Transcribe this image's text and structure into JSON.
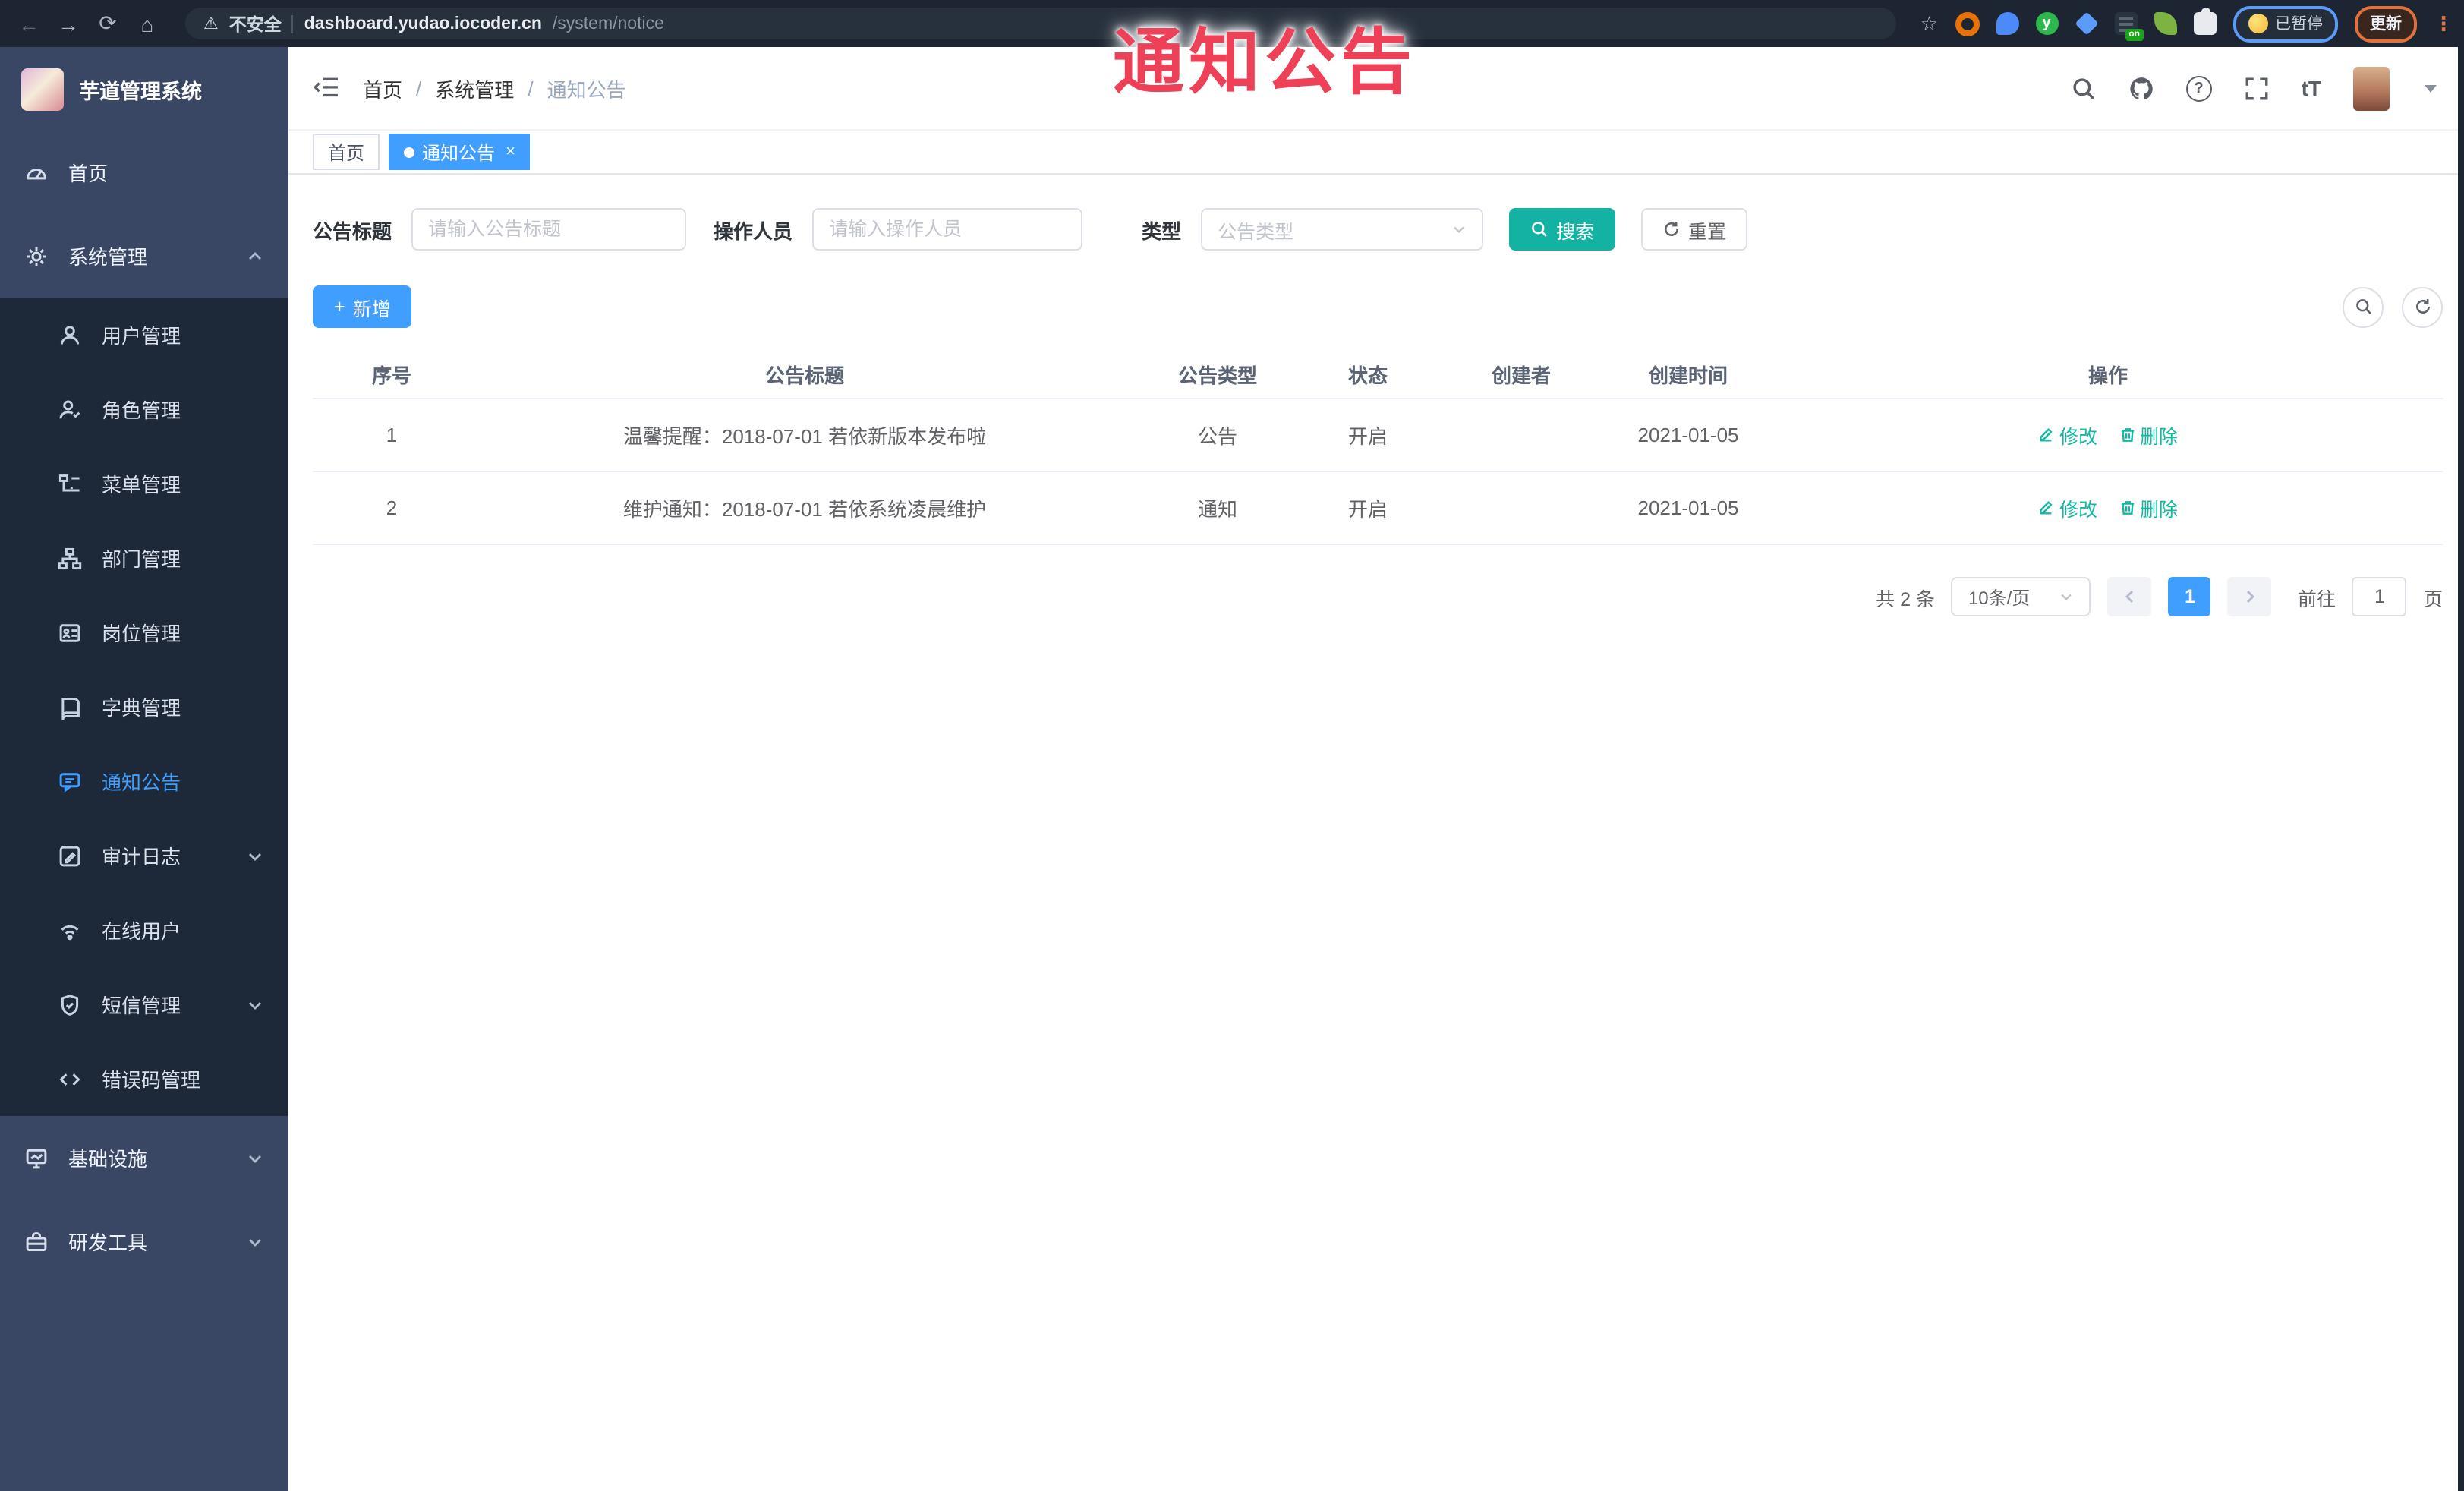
{
  "colors": {
    "accent": "#409eff",
    "teal": "#14b2a2",
    "overlay_red": "#ee4158",
    "sidebar_bg": "#3a4764",
    "submenu_bg": "#1d2838",
    "chrome_bg": "#1c2531"
  },
  "overlay": {
    "label": "通知公告"
  },
  "browser": {
    "insecure_label": "不安全",
    "url_domain": "dashboard.yudao.iocoder.cn",
    "url_path": "/system/notice",
    "ext_on_badge": "on",
    "ext_y_glyph": "y",
    "paused_label": "已暂停",
    "update_label": "更新",
    "kebab_glyph": "⋮",
    "back_glyph": "←",
    "forward_glyph": "→",
    "reload_glyph": "⟳",
    "home_glyph": "⌂",
    "star_glyph": "☆",
    "warn_glyph": "⚠"
  },
  "sidebar": {
    "app_title": "芋道管理系统",
    "items": [
      {
        "label": "首页"
      },
      {
        "label": "系统管理"
      },
      {
        "label": "用户管理"
      },
      {
        "label": "角色管理"
      },
      {
        "label": "菜单管理"
      },
      {
        "label": "部门管理"
      },
      {
        "label": "岗位管理"
      },
      {
        "label": "字典管理"
      },
      {
        "label": "通知公告"
      },
      {
        "label": "审计日志"
      },
      {
        "label": "在线用户"
      },
      {
        "label": "短信管理"
      },
      {
        "label": "错误码管理"
      },
      {
        "label": "基础设施"
      },
      {
        "label": "研发工具"
      }
    ]
  },
  "header": {
    "breadcrumb": [
      "首页",
      "系统管理",
      "通知公告"
    ],
    "breadcrumb_separator": "/",
    "help_glyph": "?",
    "font_size_label": "tT"
  },
  "tabs": {
    "close_glyph": "×",
    "items": [
      {
        "label": "首页"
      },
      {
        "label": "通知公告"
      }
    ]
  },
  "filters": {
    "title_label": "公告标题",
    "title_placeholder": "请输入公告标题",
    "operator_label": "操作人员",
    "operator_placeholder": "请输入操作人员",
    "type_label": "类型",
    "type_placeholder": "公告类型",
    "search_label": "搜索",
    "reset_label": "重置"
  },
  "toolbar": {
    "add_label": "新增",
    "add_plus": "+"
  },
  "table": {
    "headers": [
      "序号",
      "公告标题",
      "公告类型",
      "状态",
      "创建者",
      "创建时间",
      "操作"
    ],
    "edit_label": "修改",
    "delete_label": "删除",
    "rows": [
      {
        "index": "1",
        "title": "温馨提醒：2018-07-01 若依新版本发布啦",
        "type": "公告",
        "status": "开启",
        "creator": "",
        "create_time": "2021-01-05"
      },
      {
        "index": "2",
        "title": "维护通知：2018-07-01 若依系统凌晨维护",
        "type": "通知",
        "status": "开启",
        "creator": "",
        "create_time": "2021-01-05"
      }
    ]
  },
  "pagination": {
    "total_label": "共 2 条",
    "page_size": "10条/页",
    "current_page": "1",
    "goto_label": "前往",
    "goto_value": "1",
    "page_unit": "页"
  }
}
